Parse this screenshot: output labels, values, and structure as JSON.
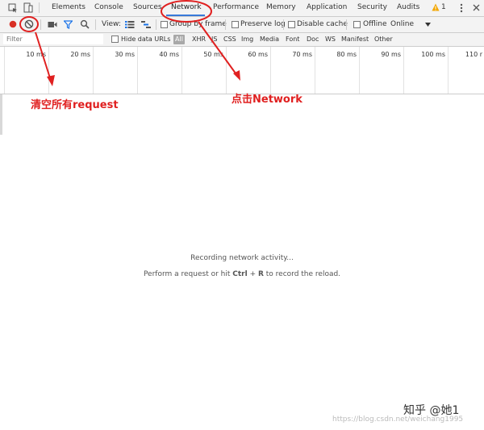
{
  "tabs": [
    {
      "label": "Elements"
    },
    {
      "label": "Console"
    },
    {
      "label": "Sources"
    },
    {
      "label": "Network",
      "active": true
    },
    {
      "label": "Performance"
    },
    {
      "label": "Memory"
    },
    {
      "label": "Application"
    },
    {
      "label": "Security"
    },
    {
      "label": "Audits"
    }
  ],
  "warning_count": "1",
  "toolbar": {
    "view_label": "View:",
    "group_by_frame": "Group by frame",
    "preserve_log": "Preserve log",
    "disable_cache": "Disable cache",
    "offline": "Offline",
    "throttle_value": "Online"
  },
  "filter": {
    "placeholder": "Filter",
    "hide_data_urls": "Hide data URLs",
    "types": [
      "All",
      "XHR",
      "JS",
      "CSS",
      "Img",
      "Media",
      "Font",
      "Doc",
      "WS",
      "Manifest",
      "Other"
    ]
  },
  "timeline": {
    "ticks": [
      "10 ms",
      "20 ms",
      "30 ms",
      "40 ms",
      "50 ms",
      "60 ms",
      "70 ms",
      "80 ms",
      "90 ms",
      "100 ms",
      "110 r"
    ]
  },
  "empty_state": {
    "line1": "Recording network activity...",
    "line2_prefix": "Perform a request or hit ",
    "line2_key1": "Ctrl",
    "line2_plus": " + ",
    "line2_key2": "R",
    "line2_suffix": " to record the reload."
  },
  "annotations": {
    "clear_label": "清空所有request",
    "network_label": "点击Network"
  },
  "watermark": {
    "zhihu": "知乎 @她1",
    "url": "https://blog.csdn.net/weichang1995"
  },
  "colors": {
    "record": "#d93025",
    "annotation": "#e02020",
    "filter_icon": "#1a73e8",
    "active_tab_underline": "#3879d9"
  }
}
